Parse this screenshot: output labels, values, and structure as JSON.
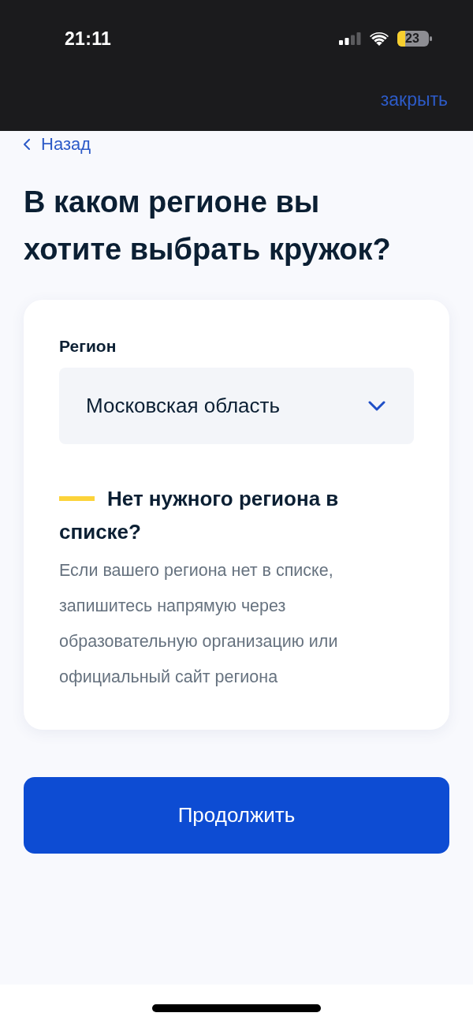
{
  "status_bar": {
    "time": "21:11",
    "battery": "23"
  },
  "header": {
    "close_label": "закрыть"
  },
  "back_link": {
    "label": "Назад"
  },
  "title": "В каком регионе вы хотите выбрать кружок?",
  "card": {
    "field": {
      "label": "Регион",
      "value": "Московская область"
    },
    "notice": {
      "title": "Нет нужного региона в списке?",
      "text": "Если вашего региона нет в списке, запишитесь напрямую через образовательную организацию или официальный сайт региона"
    }
  },
  "buttons": [
    {
      "label": "Продолжить"
    }
  ]
}
